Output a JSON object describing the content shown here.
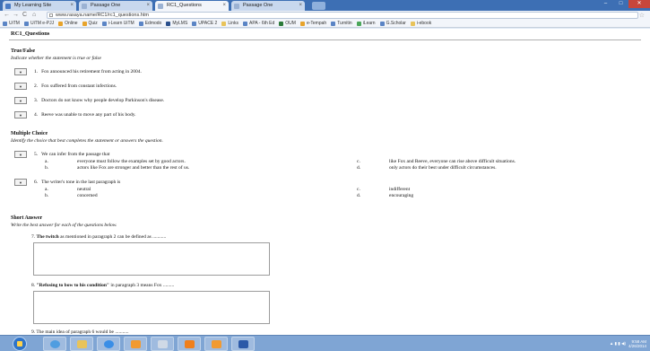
{
  "browser": {
    "tabs": [
      {
        "label": "My Learning Site"
      },
      {
        "label": "Passage One"
      },
      {
        "label": "RC1_Questions"
      },
      {
        "label": "Passage One"
      }
    ],
    "url": "www.rasaya.name/RC1/rc1_questions.htm",
    "window_buttons": [
      "–",
      "□",
      "✕"
    ]
  },
  "bookmarks": [
    "UiTM",
    "UiTM e-PJJ",
    "Online",
    "Quiz",
    "i-Learn UiTM",
    "Edmodo",
    "MyLMS",
    "UPACE 2",
    "Links",
    "APA - 6th Ed",
    "OUM",
    "e-Tempah",
    "Turnitin",
    "iLearn",
    "G.Scholar",
    "i-ebook"
  ],
  "page": {
    "title": "RC1_Questions",
    "true_false": {
      "heading": "True/False",
      "instruction": "Indicate whether the statement is true or false",
      "items": [
        {
          "num": "1.",
          "text": "Fox announced his retirement from acting in 2004."
        },
        {
          "num": "2.",
          "text": "Fox suffered from constant infections."
        },
        {
          "num": "3.",
          "text": "Doctors do not know why people develop Parkinson's disease."
        },
        {
          "num": "4.",
          "text": "Reeve was unable to move any part of his body."
        }
      ]
    },
    "multiple_choice": {
      "heading": "Multiple Choice",
      "instruction": "Identify the choice that best completes the statement or answers the question.",
      "items": [
        {
          "num": "5.",
          "stem": "We can infer from the passage that",
          "a": "everyone must follow the examples set by good actors.",
          "b": "actors like Fox are stronger and better than the rest of us.",
          "c": "like Fox and Reeve, everyone can rise above difficult situations.",
          "d": "only actors do their best under difficult circumstances."
        },
        {
          "num": "6.",
          "stem": "The writer's tone in the last paragraph is",
          "a": "neutral",
          "b": "concerned",
          "c": "indifferent",
          "d": "encouraging"
        }
      ]
    },
    "short_answer": {
      "heading": "Short Answer",
      "instruction": "Write the best answer for each of the questions below.",
      "items": [
        {
          "num": "7.",
          "bold": "The twitch",
          "rest": " as mentioned in paragraph 2 can be defined as ..........."
        },
        {
          "num": "8.",
          "bold": "\"Refusing to bow to his condition\"",
          "rest": " in paragraph 3 means Fox ........."
        },
        {
          "num": "9.",
          "bold": "",
          "rest": "The main idea of paragraph 6 would be ..........."
        }
      ]
    }
  },
  "taskbar": {
    "clock_time": "9:58 AM",
    "clock_date": "4/26/2014"
  },
  "colors": {
    "titlebar": "#3d6fb4",
    "taskbar": "#7fa5d4",
    "close_button": "#c7463b"
  }
}
